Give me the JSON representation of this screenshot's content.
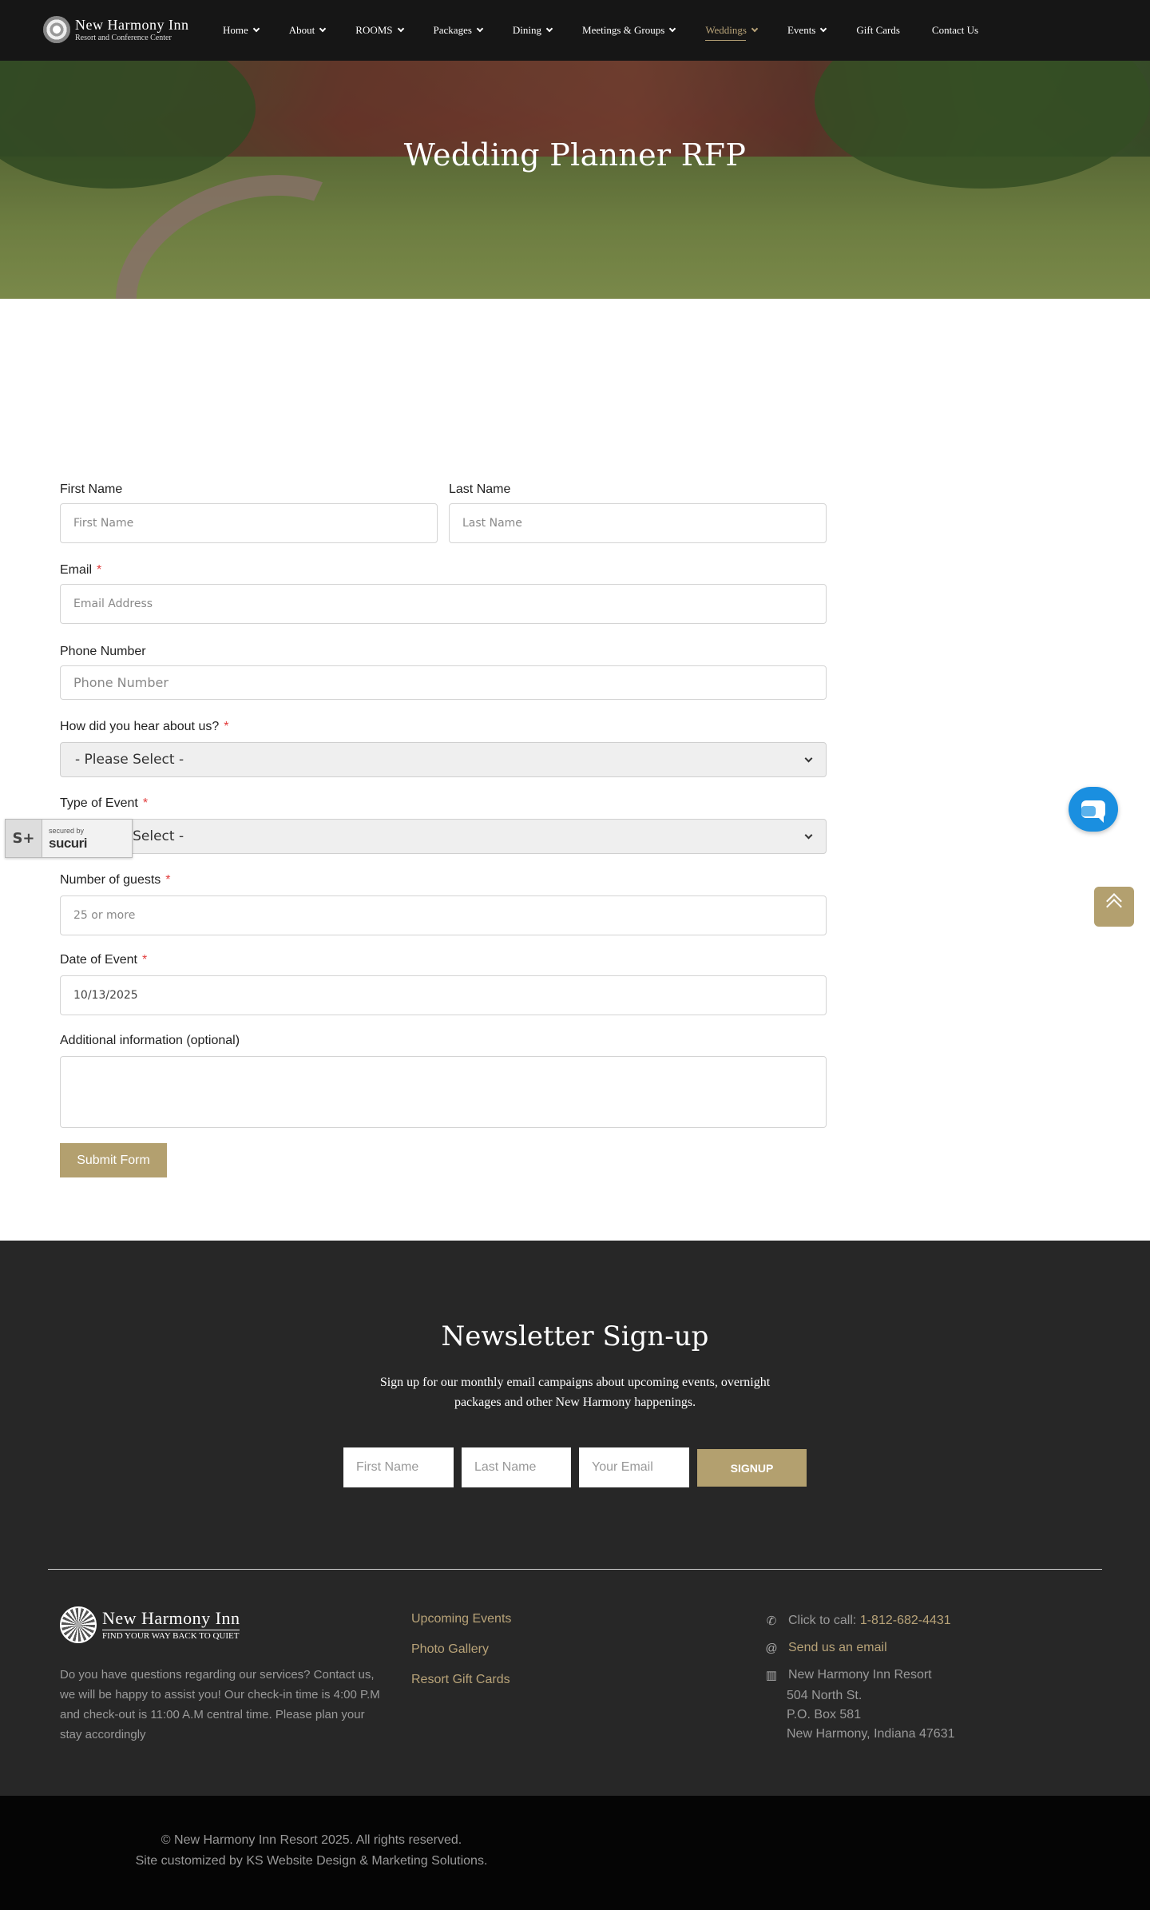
{
  "header": {
    "logo": {
      "line1": "New Harmony Inn",
      "line2": "Resort and Conference Center"
    },
    "nav": [
      {
        "label": "Home",
        "dropdown": true
      },
      {
        "label": "About",
        "dropdown": true
      },
      {
        "label": "ROOMS",
        "dropdown": true
      },
      {
        "label": "Packages",
        "dropdown": true
      },
      {
        "label": "Dining",
        "dropdown": true
      },
      {
        "label": "Meetings & Groups",
        "dropdown": true
      },
      {
        "label": "Weddings",
        "dropdown": true,
        "active": true
      },
      {
        "label": "Events",
        "dropdown": true
      },
      {
        "label": "Gift Cards",
        "dropdown": false
      },
      {
        "label": "Contact Us",
        "dropdown": false
      }
    ]
  },
  "hero": {
    "title": "Wedding Planner RFP"
  },
  "form": {
    "first_name": {
      "label": "First Name",
      "placeholder": "First Name"
    },
    "last_name": {
      "label": "Last Name",
      "placeholder": "Last Name"
    },
    "email": {
      "label": "Email",
      "required": "*",
      "placeholder": "Email Address"
    },
    "phone": {
      "label": "Phone Number",
      "placeholder": "Phone Number"
    },
    "heard": {
      "label": "How did you hear about us?",
      "required": "*",
      "selected": "- Please Select -"
    },
    "event_type": {
      "label": "Type of Event",
      "required": "*",
      "selected": "- Please Select -"
    },
    "guests": {
      "label": "Number of guests",
      "required": "*",
      "placeholder": "25 or more"
    },
    "date": {
      "label": "Date of Event",
      "required": "*",
      "value": "10/13/2025"
    },
    "additional": {
      "label": "Additional information (optional)",
      "value": ""
    },
    "submit_label": "Submit Form"
  },
  "sucuri_badge": {
    "line1": "secured by",
    "line2": "sucuri"
  },
  "newsletter": {
    "title": "Newsletter Sign-up",
    "text": "Sign up for our monthly email campaigns about upcoming events, overnight packages and other New Harmony happenings.",
    "first_name_placeholder": "First Name",
    "last_name_placeholder": "Last Name",
    "email_placeholder": "Your Email",
    "button_label": "SIGNUP"
  },
  "footer": {
    "logo": {
      "line1": "New Harmony Inn",
      "line2": "FIND YOUR WAY BACK TO QUIET"
    },
    "about": "Do you have questions regarding our services? Contact us, we will be happy to assist you! Our check-in time is 4:00 P.M and check-out is 11:00 A.M central time. Please plan your stay accordingly",
    "links": [
      "Upcoming Events",
      "Photo Gallery",
      "Resort Gift Cards"
    ],
    "call_prefix": "Click to call:",
    "phone": "1-812-682-4431",
    "email_link": "Send us an email",
    "address": [
      "New Harmony Inn Resort",
      "504 North St.",
      "P.O. Box 581",
      "New Harmony, Indiana 47631"
    ],
    "copyright": "© New Harmony Inn Resort 2025. All rights reserved.",
    "credit": "Site customized by KS Website Design & Marketing Solutions."
  },
  "colors": {
    "accent": "#b3a06f",
    "dark": "#272727",
    "chat": "#1a8fe0"
  }
}
